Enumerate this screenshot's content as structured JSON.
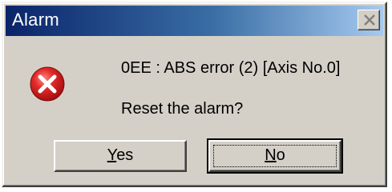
{
  "window": {
    "title": "Alarm"
  },
  "titlebar": {
    "close_icon": "close-icon"
  },
  "content": {
    "icon": "error-icon",
    "message": "0EE : ABS error (2) [Axis No.0]",
    "question": "Reset the alarm?"
  },
  "buttons": {
    "yes": {
      "mnemonic": "Y",
      "rest": "es"
    },
    "no": {
      "mnemonic": "N",
      "rest": "o"
    }
  },
  "colors": {
    "title_gradient_start": "#0a246a",
    "title_gradient_end": "#a6caf0",
    "dialog_face": "#d4d0c8",
    "error_red": "#d81e1e"
  }
}
